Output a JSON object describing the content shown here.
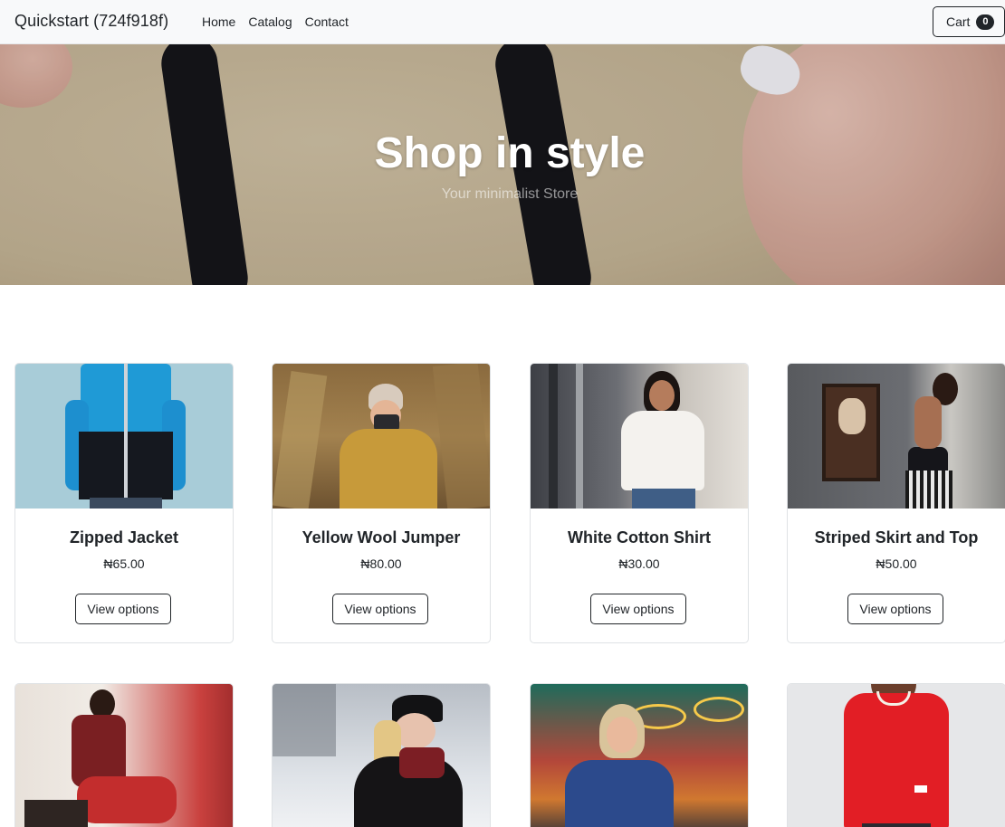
{
  "navbar": {
    "brand": "Quickstart (724f918f)",
    "links": [
      "Home",
      "Catalog",
      "Contact"
    ],
    "cart_label": "Cart",
    "cart_count": "0"
  },
  "hero": {
    "title": "Shop in style",
    "subtitle": "Your minimalist Store"
  },
  "products": [
    {
      "name": "Zipped Jacket",
      "price": "₦65.00",
      "button": "View options"
    },
    {
      "name": "Yellow Wool Jumper",
      "price": "₦80.00",
      "button": "View options"
    },
    {
      "name": "White Cotton Shirt",
      "price": "₦30.00",
      "button": "View options"
    },
    {
      "name": "Striped Skirt and Top",
      "price": "₦50.00",
      "button": "View options"
    }
  ],
  "colors": {
    "navbar_bg": "#f8f9fa",
    "text": "#212529",
    "card_border": "#dfe2e5"
  }
}
